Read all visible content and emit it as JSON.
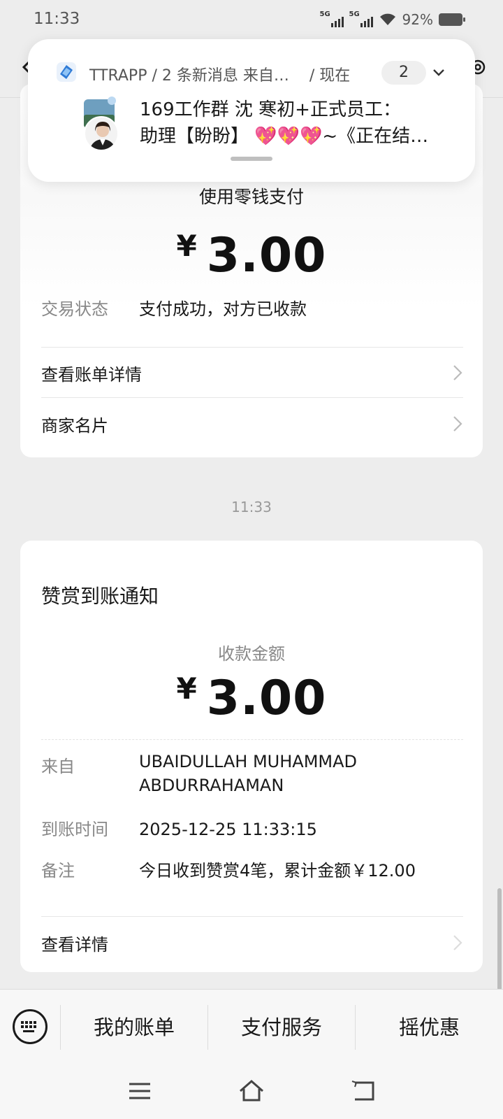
{
  "status_bar": {
    "time": "11:33",
    "signal1_label": "5G",
    "signal2_label": "5G",
    "battery": "92%"
  },
  "notification": {
    "app_name": "TTRAPP",
    "summary": "2 条新消息 来自…",
    "time": "现在",
    "count": "2",
    "line1": "169工作群  沈 寒初+正式员工：",
    "line2": "助理【盼盼】 💖💖💖~《正在结…"
  },
  "payment_card": {
    "method": "使用零钱支付",
    "currency_symbol": "¥",
    "amount": "3.00",
    "status_label": "交易状态",
    "status_value": "支付成功，对方已收款",
    "links": [
      {
        "label": "查看账单详情"
      },
      {
        "label": "商家名片"
      }
    ]
  },
  "timestamp": "11:33",
  "reward_card": {
    "title": "赞赏到账通知",
    "subtitle": "收款金额",
    "currency_symbol": "¥",
    "amount": "3.00",
    "from_label": "来自",
    "from_line1": "UBAIDULLAH MUHAMMAD",
    "from_line2": "ABDURRAHAMAN",
    "arrival_label": "到账时间",
    "arrival_value": "2025-12-25 11:33:15",
    "note_label": "备注",
    "note_value": "今日收到赞赏4笔，累计金额￥12.00",
    "detail_link": "查看详情"
  },
  "bottom_menu": {
    "items": [
      {
        "label": "我的账单"
      },
      {
        "label": "支付服务"
      },
      {
        "label": "摇优惠"
      }
    ]
  },
  "icons": {
    "back": "back-chevron-icon",
    "more": "gear-icon",
    "keyboard": "keyboard-icon",
    "nav_menu": "menu-lines-icon",
    "nav_home": "home-icon",
    "nav_back": "back-arrow-icon"
  }
}
